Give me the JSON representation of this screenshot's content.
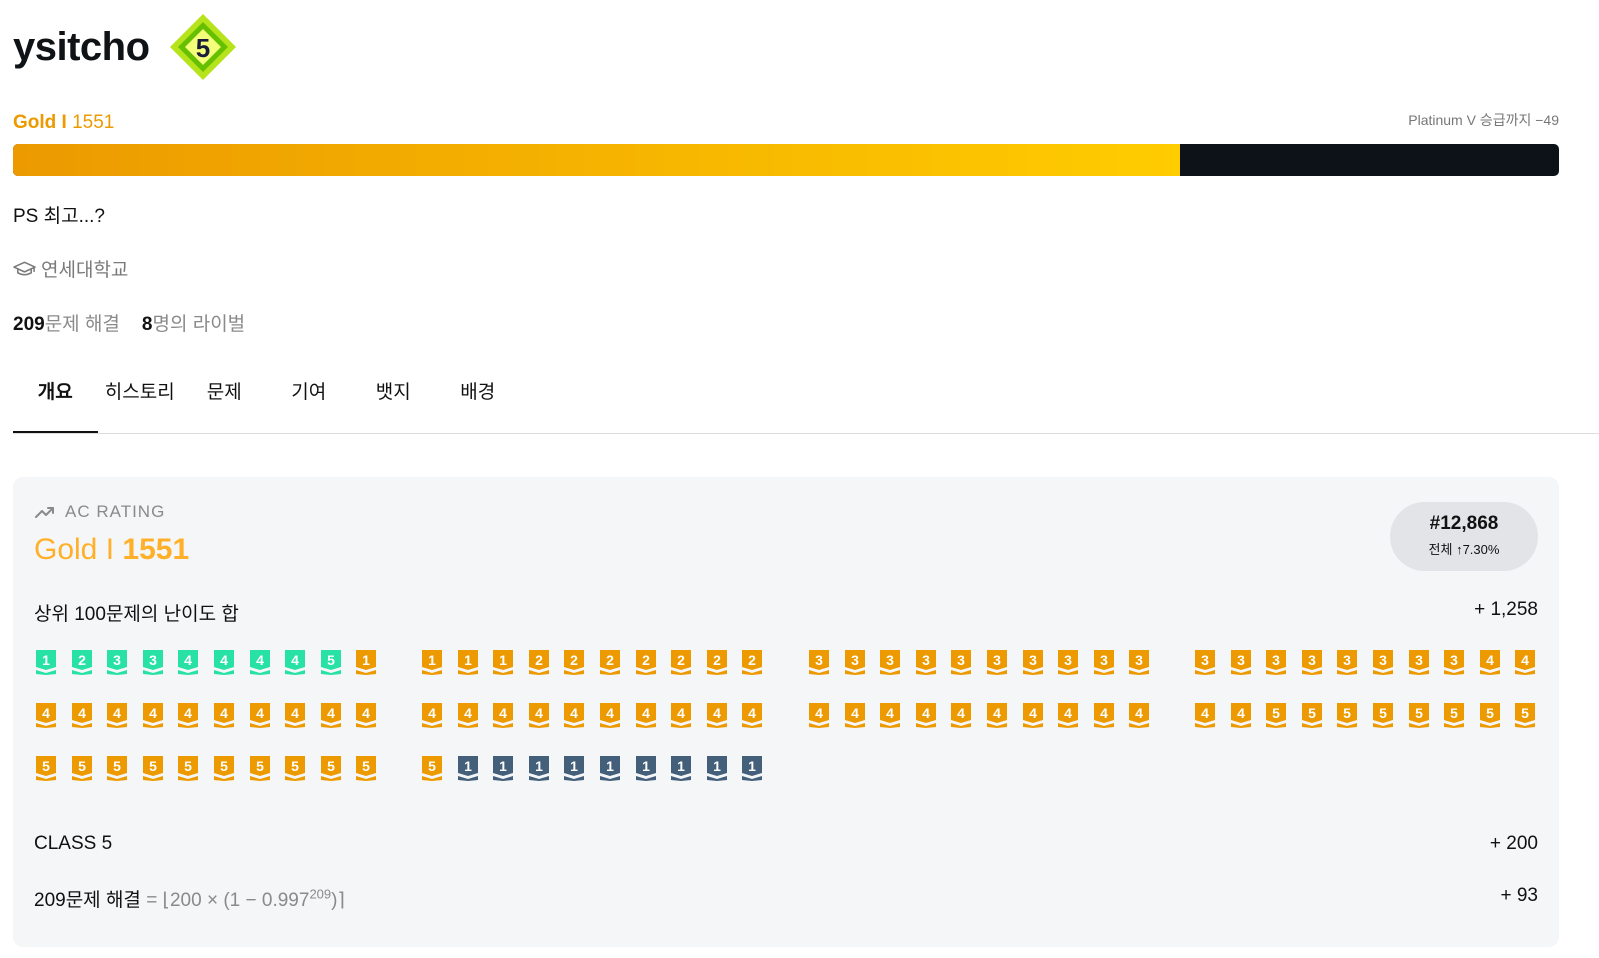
{
  "profile": {
    "username": "ysitcho",
    "class_badge": {
      "value": "5",
      "icon": "class-diamond-icon",
      "colors": [
        "#c3f000",
        "#4caf00"
      ]
    },
    "tier": "Gold I",
    "rating": "1551",
    "promotion_text": "Platinum V 승급까지 −49",
    "progress_fraction": 0.755,
    "bio": "PS 최고...?",
    "school": "연세대학교",
    "solved_count": "209",
    "solved_label": "문제 해결",
    "rival_count": "8",
    "rival_label": "명의 라이벌"
  },
  "tabs": [
    "개요",
    "히스토리",
    "문제",
    "기여",
    "뱃지",
    "배경"
  ],
  "active_tab": 0,
  "ac_rating": {
    "label": "AC RATING",
    "tier": "Gold I",
    "rating": "1551",
    "rank": "#12,868",
    "rank_pct": "전체 ↑7.30%",
    "top100_label": "상위 100문제의 난이도 합",
    "top100_value": "+ 1,258",
    "class_label": "CLASS 5",
    "class_value": "+ 200",
    "solved_label": "209문제 해결",
    "solved_formula_prefix": "= ⌊200 × (1 − 0.997",
    "solved_formula_exp": "209",
    "solved_formula_suffix": ")⌉",
    "solved_value": "+ 93"
  },
  "colors": {
    "gold": "#ec9a00",
    "silver": "#435f7a",
    "platinum": "#27e2a4",
    "ac_gold": "#ffb028"
  },
  "top_problems": [
    "P1",
    "P2",
    "P3",
    "P3",
    "P4",
    "P4",
    "P4",
    "P4",
    "P5",
    "G1",
    "G1",
    "G1",
    "G1",
    "G2",
    "G2",
    "G2",
    "G2",
    "G2",
    "G2",
    "G2",
    "G3",
    "G3",
    "G3",
    "G3",
    "G3",
    "G3",
    "G3",
    "G3",
    "G3",
    "G3",
    "G3",
    "G3",
    "G3",
    "G3",
    "G3",
    "G3",
    "G3",
    "G3",
    "G4",
    "G4",
    "G4",
    "G4",
    "G4",
    "G4",
    "G4",
    "G4",
    "G4",
    "G4",
    "G4",
    "G4",
    "G4",
    "G4",
    "G4",
    "G4",
    "G4",
    "G4",
    "G4",
    "G4",
    "G4",
    "G4",
    "G4",
    "G4",
    "G4",
    "G4",
    "G4",
    "G4",
    "G4",
    "G4",
    "G4",
    "G4",
    "G4",
    "G4",
    "G5",
    "G5",
    "G5",
    "G5",
    "G5",
    "G5",
    "G5",
    "G5",
    "G5",
    "G5",
    "G5",
    "G5",
    "G5",
    "G5",
    "G5",
    "G5",
    "G5",
    "G5",
    "G5",
    "S1",
    "S1",
    "S1",
    "S1",
    "S1",
    "S1",
    "S1",
    "S1",
    "S1"
  ]
}
